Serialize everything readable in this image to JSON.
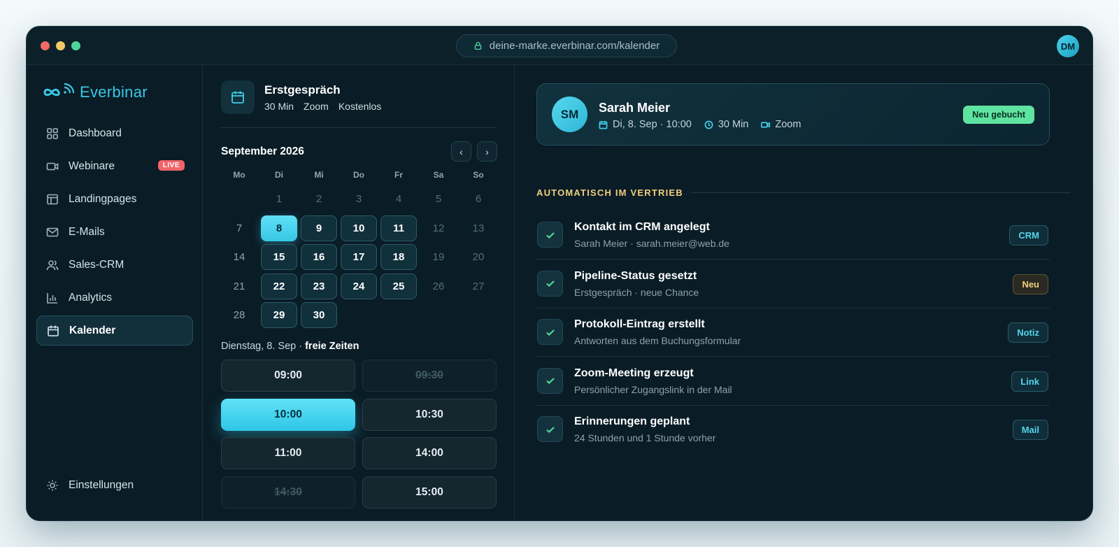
{
  "browser": {
    "url": "deine-marke.everbinar.com/kalender",
    "user_initials": "DM"
  },
  "brand": {
    "name": "Everbinar",
    "accent": "#37c8e6"
  },
  "sidebar": {
    "items": [
      {
        "label": "Dashboard",
        "icon": "grid-icon"
      },
      {
        "label": "Webinare",
        "icon": "video-icon",
        "badge": "LIVE"
      },
      {
        "label": "Landingpages",
        "icon": "layout-icon"
      },
      {
        "label": "E-Mails",
        "icon": "mail-icon"
      },
      {
        "label": "Sales-CRM",
        "icon": "users-icon"
      },
      {
        "label": "Analytics",
        "icon": "bar-chart-icon"
      },
      {
        "label": "Kalender",
        "icon": "calendar-icon",
        "active": true
      }
    ],
    "settings_label": "Einstellungen"
  },
  "event": {
    "title": "Erstgespräch",
    "duration": "30 Min",
    "platform": "Zoom",
    "price": "Kostenlos"
  },
  "calendar": {
    "month_label": "September 2026",
    "prev": "‹",
    "next": "›",
    "weekdays": [
      "Mo",
      "Di",
      "Mi",
      "Do",
      "Fr",
      "Sa",
      "So"
    ],
    "days": [
      "1",
      "2",
      "3",
      "4",
      "5",
      "6",
      "7",
      "8",
      "9",
      "10",
      "11",
      "12",
      "13",
      "14",
      "15",
      "16",
      "17",
      "18",
      "19",
      "20",
      "21",
      "22",
      "23",
      "24",
      "25",
      "26",
      "27",
      "28",
      "29",
      "30"
    ],
    "available_days": [
      "8",
      "9",
      "10",
      "11",
      "15",
      "16",
      "17",
      "18",
      "22",
      "23",
      "24",
      "25",
      "29",
      "30"
    ],
    "selected_day": "8"
  },
  "slots": {
    "date_label": "Dienstag, 8. Sep · ",
    "free_label": "freie Zeiten",
    "times": [
      {
        "time": "09:00",
        "state": "available"
      },
      {
        "time": "09:30",
        "state": "disabled"
      },
      {
        "time": "10:00",
        "state": "selected"
      },
      {
        "time": "10:30",
        "state": "available"
      },
      {
        "time": "11:00",
        "state": "available"
      },
      {
        "time": "14:00",
        "state": "available"
      },
      {
        "time": "14:30",
        "state": "disabled"
      },
      {
        "time": "15:00",
        "state": "available"
      }
    ]
  },
  "booking": {
    "initials": "SM",
    "name": "Sarah Meier",
    "date": "Di, 8. Sep · 10:00",
    "duration": "30 Min",
    "platform": "Zoom",
    "status": "Neu gebucht"
  },
  "automation": {
    "title": "AUTOMATISCH IM VERTRIEB",
    "tasks": [
      {
        "title": "Kontakt im CRM angelegt",
        "sub": "Sarah Meier · sarah.meier@web.de",
        "tag": "CRM",
        "tag_style": "cyan"
      },
      {
        "title": "Pipeline-Status gesetzt",
        "sub": "Erstgespräch · neue Chance",
        "tag": "Neu",
        "tag_style": "gold"
      },
      {
        "title": "Protokoll-Eintrag erstellt",
        "sub": "Antworten aus dem Buchungsformular",
        "tag": "Notiz",
        "tag_style": "cyan"
      },
      {
        "title": "Zoom-Meeting erzeugt",
        "sub": "Persönlicher Zugangslink in der Mail",
        "tag": "Link",
        "tag_style": "cyan"
      },
      {
        "title": "Erinnerungen geplant",
        "sub": "24 Stunden und 1 Stunde vorher",
        "tag": "Mail",
        "tag_style": "cyan"
      }
    ]
  }
}
